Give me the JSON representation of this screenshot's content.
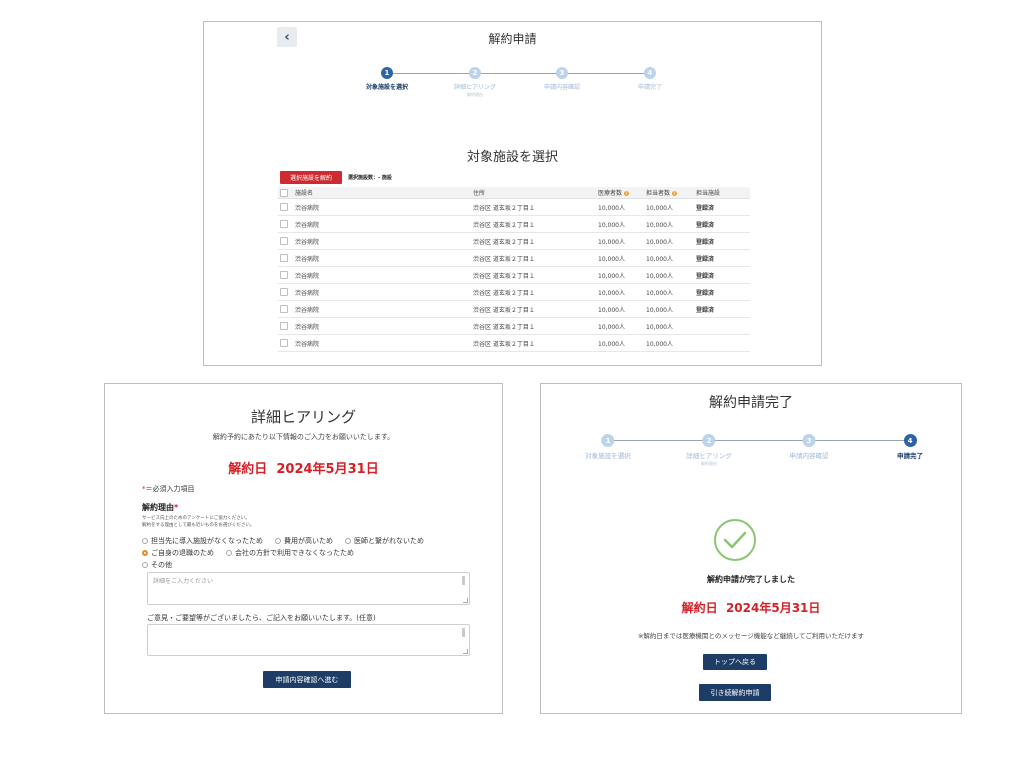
{
  "colors": {
    "primary_navy": "#1d3d67",
    "danger_red": "#cf2a2f",
    "step_active": "#2c64a5",
    "step_inactive": "#bcd3ec",
    "link": "#2c6fb8",
    "success_green": "#8cc56f"
  },
  "top_panel": {
    "back_icon": "chevron-left-icon",
    "header_title": "解約申請",
    "steps": [
      {
        "number": "1",
        "label": "対象施設を選択",
        "sub": "",
        "state": "active"
      },
      {
        "number": "2",
        "label": "詳細ヒアリング",
        "sub": "解約理由",
        "state": "inactive"
      },
      {
        "number": "3",
        "label": "申請内容確認",
        "sub": "",
        "state": "inactive"
      },
      {
        "number": "4",
        "label": "申請完了",
        "sub": "",
        "state": "inactive"
      }
    ],
    "section_title": "対象施設を選択",
    "cancel_button": "選択施設を解約",
    "selected_count": "選択施設数：- 施設",
    "table": {
      "headers": {
        "name": "施設名",
        "address": "住所",
        "medical_count": "医療者数",
        "staff_count": "担当者数",
        "assigned": "担当施設"
      },
      "rows": [
        {
          "name": "渋谷病院",
          "address": "渋谷区 道玄坂２丁目１",
          "medical": "10,000人",
          "staff": "10,000人",
          "status": "登録済"
        },
        {
          "name": "渋谷病院",
          "address": "渋谷区 道玄坂２丁目１",
          "medical": "10,000人",
          "staff": "10,000人",
          "status": "登録済"
        },
        {
          "name": "渋谷病院",
          "address": "渋谷区 道玄坂２丁目１",
          "medical": "10,000人",
          "staff": "10,000人",
          "status": "登録済"
        },
        {
          "name": "渋谷病院",
          "address": "渋谷区 道玄坂２丁目１",
          "medical": "10,000人",
          "staff": "10,000人",
          "status": "登録済"
        },
        {
          "name": "渋谷病院",
          "address": "渋谷区 道玄坂２丁目１",
          "medical": "10,000人",
          "staff": "10,000人",
          "status": "登録済"
        },
        {
          "name": "渋谷病院",
          "address": "渋谷区 道玄坂２丁目１",
          "medical": "10,000人",
          "staff": "10,000人",
          "status": "登録済"
        },
        {
          "name": "渋谷病院",
          "address": "渋谷区 道玄坂２丁目１",
          "medical": "10,000人",
          "staff": "10,000人",
          "status": "登録済"
        },
        {
          "name": "渋谷病院",
          "address": "渋谷区 道玄坂２丁目１",
          "medical": "10,000人",
          "staff": "10,000人",
          "status": ""
        },
        {
          "name": "渋谷病院",
          "address": "渋谷区 道玄坂２丁目１",
          "medical": "10,000人",
          "staff": "10,000人",
          "status": ""
        }
      ]
    }
  },
  "hearing_panel": {
    "title": "詳細ヒアリング",
    "intro": "解約予約にあたり以下情報のご入力をお願いいたします。",
    "date_label": "解約日",
    "date_value": "2024年5月31日",
    "required_star": "*",
    "required_note": "＝必須入力項目",
    "reason_label": "解約理由",
    "reason_star": "*",
    "reason_help_1": "サービス向上のためのアンケートにご協力ください。",
    "reason_help_2": "解約をする理由として最も近いものをお選びください。",
    "options_row1": [
      {
        "label": "担当先に導入施設がなくなったため",
        "selected": false
      },
      {
        "label": "費用が高いため",
        "selected": false
      },
      {
        "label": "医師と繋がれないため",
        "selected": false
      }
    ],
    "options_row2": [
      {
        "label": "ご自身の退職のため",
        "selected": true
      },
      {
        "label": "会社の方針で利用できなくなったため",
        "selected": false
      }
    ],
    "options_row3": [
      {
        "label": "その他",
        "selected": false
      }
    ],
    "details_placeholder": "詳細をご入力ください",
    "opinion_label": "ご意見・ご要望等がございましたら、ご記入をお願いいたします。(任意)",
    "next_button": "申請内容確認へ進む"
  },
  "complete_panel": {
    "title": "解約申請完了",
    "steps": [
      {
        "number": "1",
        "label": "対象施設を選択",
        "sub": "",
        "state": "inactive"
      },
      {
        "number": "2",
        "label": "詳細ヒアリング",
        "sub": "解約理由",
        "state": "inactive"
      },
      {
        "number": "3",
        "label": "申請内容確認",
        "sub": "",
        "state": "inactive"
      },
      {
        "number": "4",
        "label": "申請完了",
        "sub": "",
        "state": "active"
      }
    ],
    "check_icon": "check-circle-icon",
    "done_message": "解約申請が完了しました",
    "date_label": "解約日",
    "date_value": "2024年5月31日",
    "note": "※解約日までは医療機関とのメッセージ機能など継続してご利用いただけます",
    "top_button": "トップへ戻る",
    "continue_button": "引き続解約申請"
  }
}
